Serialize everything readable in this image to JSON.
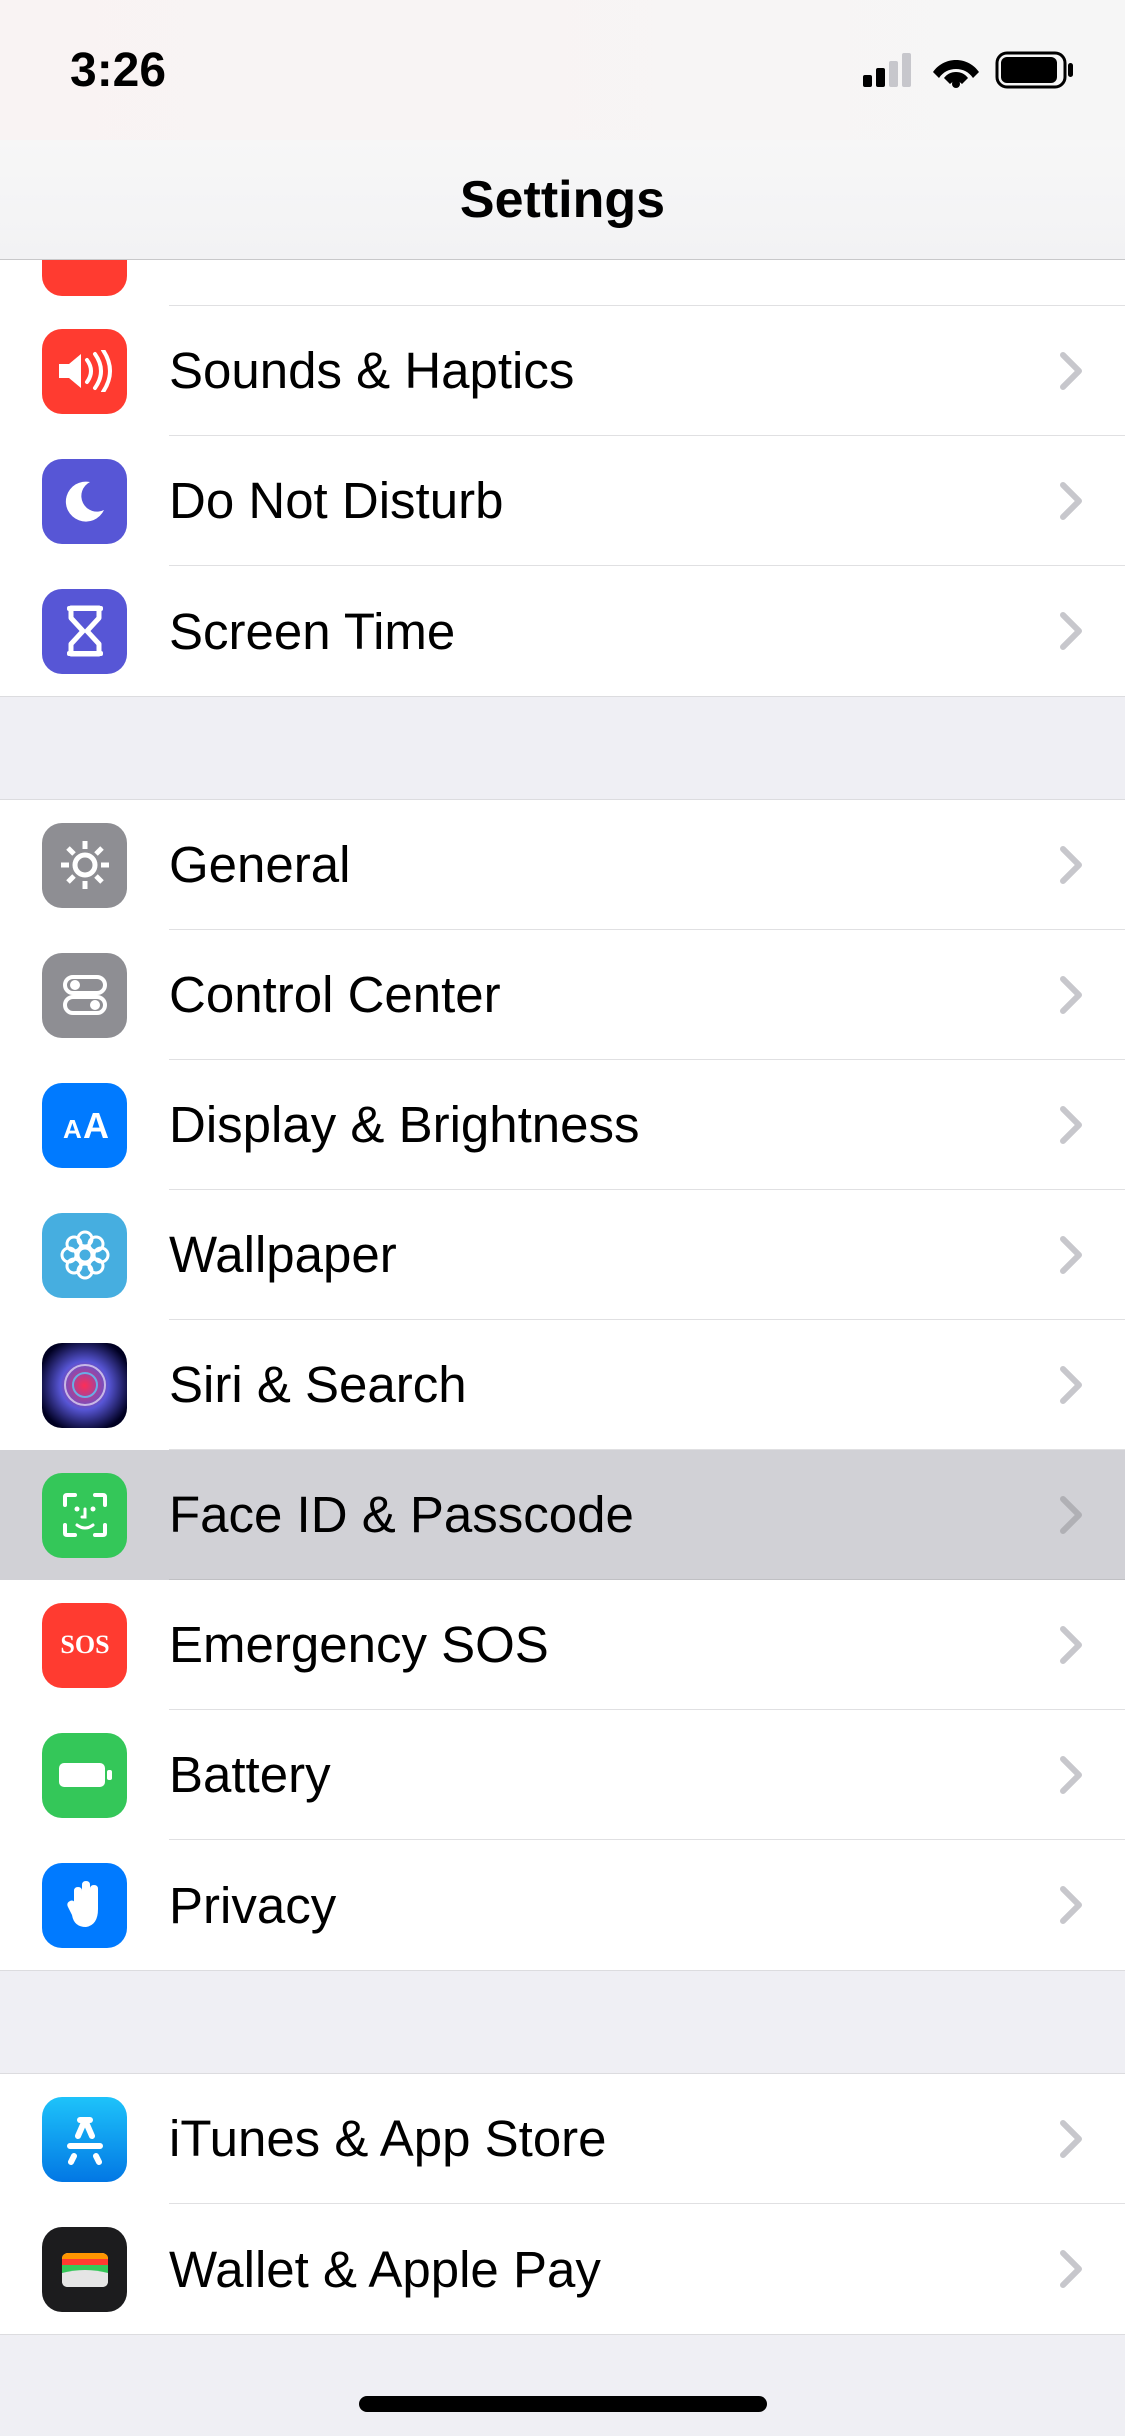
{
  "status": {
    "time": "3:26"
  },
  "header": {
    "title": "Settings"
  },
  "sections": {
    "s1": [
      {
        "label": "Sounds & Haptics",
        "icon": "sounds",
        "color": "#ff3b30"
      },
      {
        "label": "Do Not Disturb",
        "icon": "moon",
        "color": "#5756d6"
      },
      {
        "label": "Screen Time",
        "icon": "hourglass",
        "color": "#5756d6"
      }
    ],
    "s2": [
      {
        "label": "General",
        "icon": "gear",
        "color": "#8e8e93"
      },
      {
        "label": "Control Center",
        "icon": "switches",
        "color": "#8e8e93"
      },
      {
        "label": "Display & Brightness",
        "icon": "aa",
        "color": "#007aff"
      },
      {
        "label": "Wallpaper",
        "icon": "flower",
        "color": "#46aee0"
      },
      {
        "label": "Siri & Search",
        "icon": "siri",
        "color": "#1e1e2a"
      },
      {
        "label": "Face ID & Passcode",
        "icon": "faceid",
        "color": "#34c759",
        "highlighted": true
      },
      {
        "label": "Emergency SOS",
        "icon": "sos",
        "color": "#ff3b30"
      },
      {
        "label": "Battery",
        "icon": "battery",
        "color": "#34c759"
      },
      {
        "label": "Privacy",
        "icon": "hand",
        "color": "#007aff"
      }
    ],
    "s3": [
      {
        "label": "iTunes & App Store",
        "icon": "appstore",
        "color": "#1d9bf0"
      },
      {
        "label": "Wallet & Apple Pay",
        "icon": "wallet",
        "color": "#1c1c1e"
      }
    ]
  }
}
